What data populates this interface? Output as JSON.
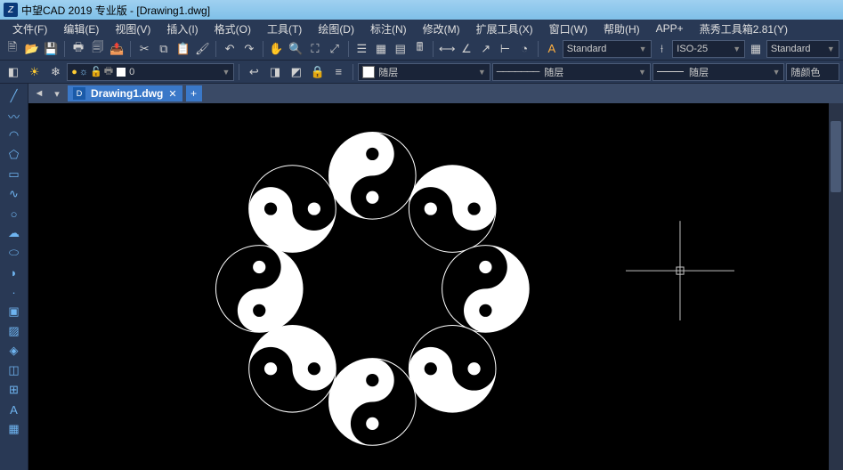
{
  "title": "中望CAD 2019 专业版 - [Drawing1.dwg]",
  "menu": {
    "file": "文件(F)",
    "edit": "编辑(E)",
    "view": "视图(V)",
    "insert": "插入(I)",
    "format": "格式(O)",
    "tools": "工具(T)",
    "draw": "绘图(D)",
    "dimension": "标注(N)",
    "modify": "修改(M)",
    "extend": "扩展工具(X)",
    "window": "窗口(W)",
    "help": "帮助(H)",
    "app": "APP+",
    "yx": "燕秀工具箱2.81(Y)"
  },
  "toolbar1": {
    "text_style": "Standard",
    "dim_style": "ISO-25",
    "table_style": "Standard"
  },
  "toolbar2": {
    "layer_combo": "随层",
    "linetype_combo": "随层",
    "color_combo": "随颜色"
  },
  "tabs": {
    "current": "Drawing1.dwg"
  }
}
